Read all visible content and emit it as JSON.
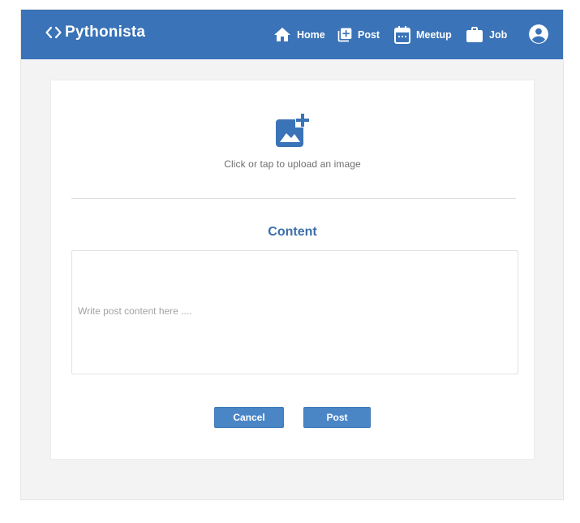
{
  "brand": {
    "name": "Pythonista",
    "icon": "code-brackets-icon"
  },
  "nav": {
    "home_label": "Home",
    "post_label": "Post",
    "meetup_label": "Meetup",
    "job_label": "Job",
    "home_icon": "home-icon",
    "post_icon": "add-box-icon",
    "meetup_icon": "calendar-icon",
    "job_icon": "briefcase-icon",
    "profile_icon": "account-circle-icon"
  },
  "upload": {
    "icon": "add-photo-icon",
    "prompt": "Click or tap to upload an image"
  },
  "content": {
    "heading": "Content",
    "placeholder": "Write post content here ....",
    "value": ""
  },
  "actions": {
    "cancel_label": "Cancel",
    "post_label": "Post"
  },
  "colors": {
    "navbar": "#3a73b7",
    "accent": "#3a6faa",
    "button": "#4a86c6",
    "page_bg": "#f4f3f4"
  }
}
